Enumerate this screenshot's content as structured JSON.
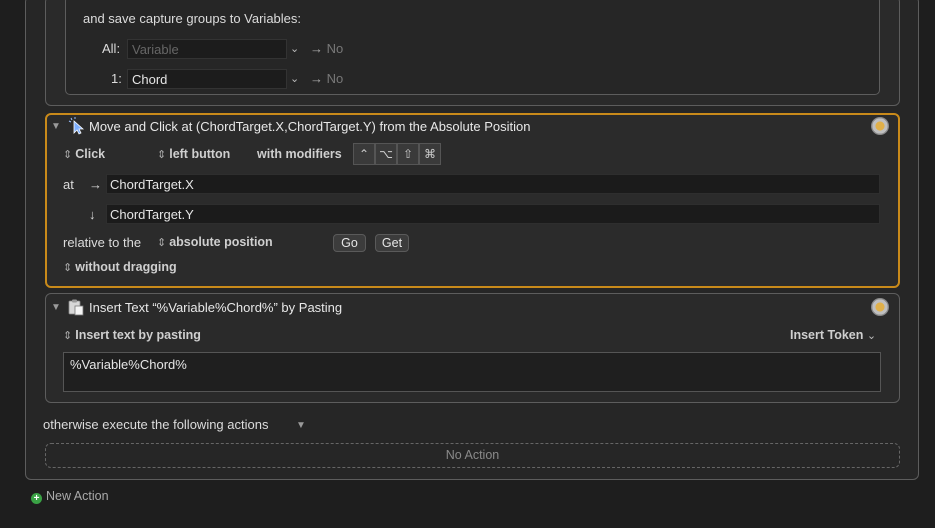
{
  "regex": {
    "save_groups_label": "and save capture groups to Variables:",
    "rows": [
      {
        "label": "All:",
        "value": "",
        "placeholder": "Variable",
        "arrow": "→",
        "result": "No"
      },
      {
        "label": "1:",
        "value": "Chord",
        "placeholder": "",
        "arrow": "→",
        "result": "No"
      }
    ]
  },
  "move_click": {
    "title": "Move and Click at (ChordTarget.X,ChordTarget.Y) from the Absolute Position",
    "click_stepper": "Click",
    "button_stepper": "left button",
    "with_modifiers_label": "with modifiers",
    "modifiers": [
      "⌃",
      "⌥",
      "⇧",
      "⌘"
    ],
    "at_label": "at",
    "x_arrow": "→",
    "y_arrow": "↓",
    "x_value": "ChordTarget.X",
    "y_value": "ChordTarget.Y",
    "relative_label": "relative to the",
    "relative_stepper": "absolute position",
    "go_label": "Go",
    "get_label": "Get",
    "drag_stepper": "without dragging",
    "accent_color": "#c98a1a"
  },
  "insert_text": {
    "title": "Insert Text “%Variable%Chord%” by Pasting",
    "mode_stepper": "Insert text by pasting",
    "insert_token_label": "Insert Token",
    "text_value": "%Variable%Chord%"
  },
  "otherwise": {
    "label": "otherwise execute the following actions",
    "no_action_label": "No Action"
  },
  "footer": {
    "new_action_label": "New Action"
  },
  "icons": {
    "gear": "gear-icon",
    "move_click": "mouse-pointer-click-icon",
    "insert_text": "clipboard-paste-icon",
    "disclosure": "disclosure-triangle-icon",
    "plus": "plus-circle-icon"
  }
}
